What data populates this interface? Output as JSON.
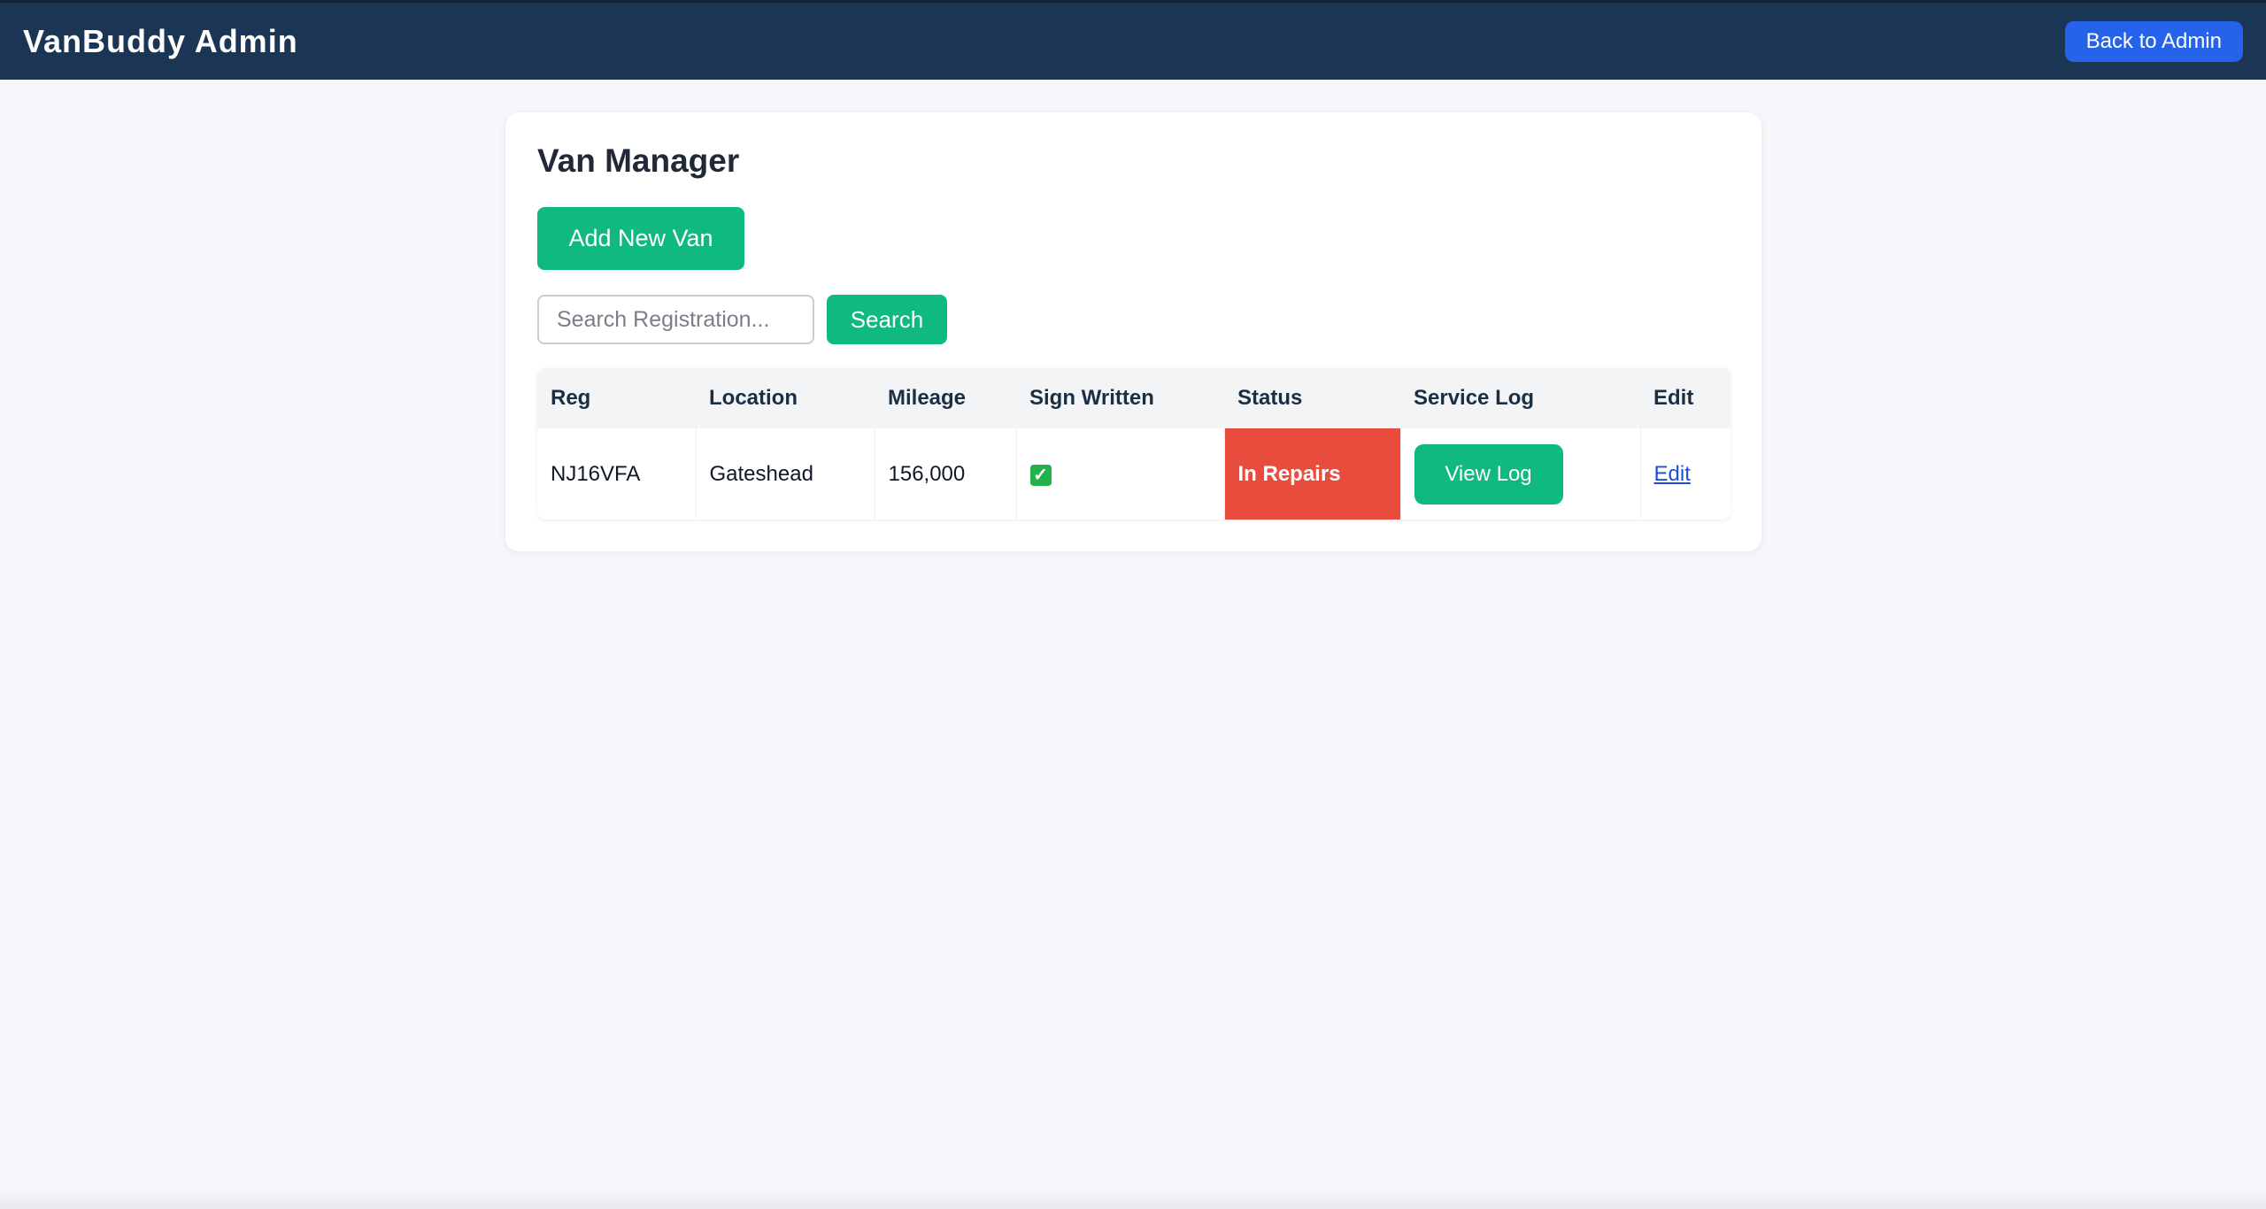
{
  "header": {
    "title": "VanBuddy Admin",
    "back_label": "Back to Admin"
  },
  "main": {
    "title": "Van Manager",
    "add_label": "Add New Van",
    "search": {
      "placeholder": "Search Registration...",
      "value": "",
      "button_label": "Search"
    },
    "table": {
      "columns": [
        "Reg",
        "Location",
        "Mileage",
        "Sign Written",
        "Status",
        "Service Log",
        "Edit"
      ],
      "rows": [
        {
          "reg": "NJ16VFA",
          "location": "Gateshead",
          "mileage": "156,000",
          "sign_written_icon": "check-mark-icon",
          "sign_written_glyph": "✓",
          "status": "In Repairs",
          "service_log_label": "View Log",
          "edit_label": "Edit"
        }
      ]
    }
  },
  "colors": {
    "header_bg": "#1b3654",
    "primary_green": "#10b981",
    "back_button_blue": "#2563eb",
    "status_repairs_red": "#e74c3c"
  }
}
